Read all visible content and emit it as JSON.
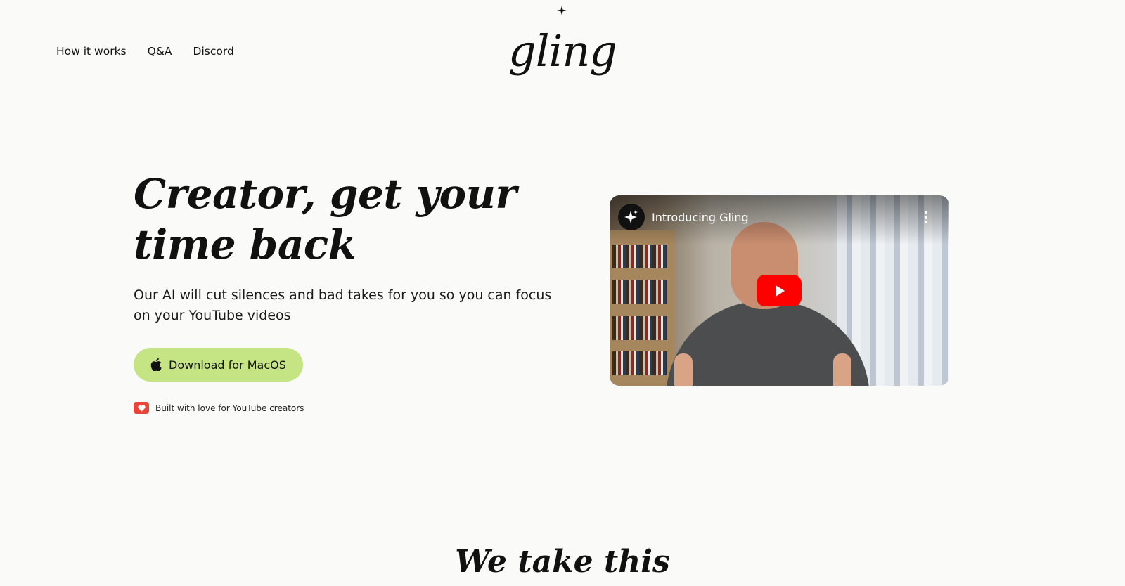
{
  "nav": {
    "items": [
      {
        "label": "How it works"
      },
      {
        "label": "Q&A"
      },
      {
        "label": "Discord"
      }
    ]
  },
  "logo": {
    "text": "gling"
  },
  "hero": {
    "title_line1": "Creator, get your",
    "title_line2": "time back",
    "subtitle": "Our AI will cut silences and bad takes for you so you can focus on your YouTube videos",
    "cta_label": "Download for MacOS",
    "built_with": "Built with love for YouTube creators"
  },
  "video": {
    "title": "Introducing Gling"
  },
  "section": {
    "title": "We take this"
  },
  "colors": {
    "background": "#fafaf8",
    "cta": "#c5e483",
    "heart_badge": "#e8443a",
    "play_button": "#ff0000"
  },
  "icons": [
    "apple-icon",
    "heart-icon",
    "sparkle-icon",
    "play-icon",
    "more-vert-icon"
  ]
}
